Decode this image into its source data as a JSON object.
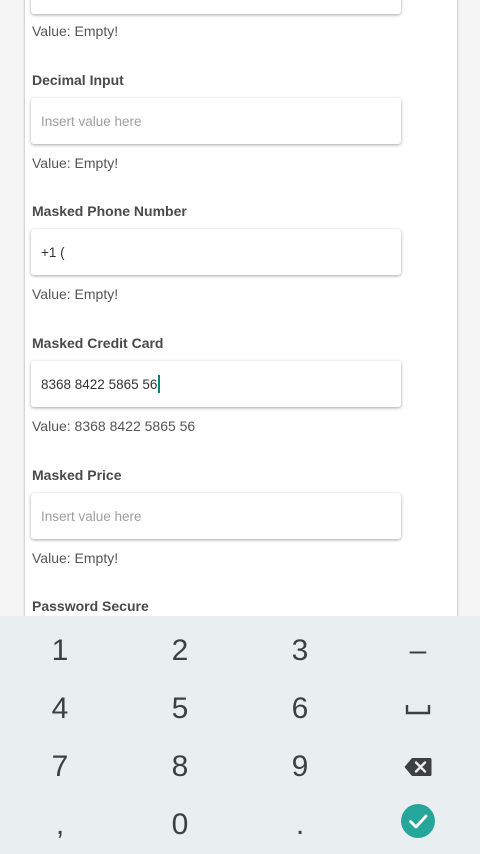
{
  "form": {
    "top_value": "Value: Empty!",
    "decimal": {
      "label": "Decimal Input",
      "placeholder": "Insert value here",
      "value_text": "Value: Empty!"
    },
    "phone": {
      "label": "Masked Phone Number",
      "input_value": "+1 (",
      "value_text": "Value: Empty!"
    },
    "credit_card": {
      "label": "Masked Credit Card",
      "input_value": "8368 8422 5865 56",
      "value_text": "Value: 8368 8422 5865 56"
    },
    "price": {
      "label": "Masked Price",
      "placeholder": "Insert value here",
      "value_text": "Value: Empty!"
    },
    "password": {
      "label": "Password Secure"
    }
  },
  "keyboard": {
    "keys": {
      "k1": "1",
      "k2": "2",
      "k3": "3",
      "minus": "–",
      "k4": "4",
      "k5": "5",
      "k6": "6",
      "k7": "7",
      "k8": "8",
      "k9": "9",
      "comma": ",",
      "k0": "0",
      "period": "."
    },
    "icons": {
      "space": "space-icon",
      "backspace": "backspace-icon",
      "done": "check-icon"
    },
    "colors": {
      "background": "#e9eef1",
      "done": "#26a69a"
    }
  }
}
